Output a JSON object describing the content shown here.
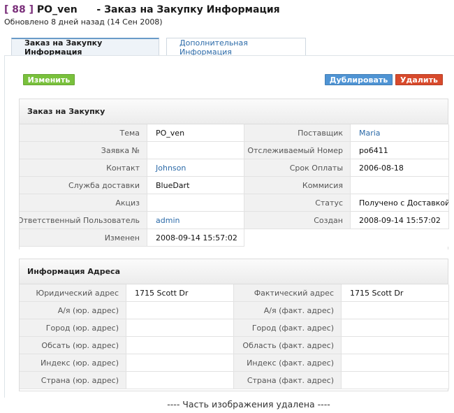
{
  "header": {
    "record_id": "[ 88 ]",
    "record_name": "PO_ven",
    "title_suffix": "- Заказ на Закупку Информация",
    "updated": "Обновлено 8 дней назад (14 Сен 2008)"
  },
  "tabs": [
    {
      "label": "Заказ на Закупку Информация",
      "active": true
    },
    {
      "label": "Дополнительная Информация",
      "active": false
    }
  ],
  "buttons": {
    "edit": "Изменить",
    "duplicate": "Дублировать",
    "delete": "Удалить"
  },
  "colors": {
    "edit": "#79c13c",
    "duplicate": "#4f94d4",
    "delete": "#d84a2c",
    "link": "#2b6aa8"
  },
  "po_section": {
    "title": "Заказ на Закупку",
    "rows": [
      {
        "l1": "Тема",
        "v1": "PO_ven",
        "l2": "Поставщик",
        "v2": "Maria"
      },
      {
        "l1": "Заявка №",
        "v1": "",
        "l2": "Отслеживаемый Номер",
        "v2": "po6411"
      },
      {
        "l1": "Контакт",
        "v1": "Johnson",
        "l2": "Срок Оплаты",
        "v2": "2006-08-18"
      },
      {
        "l1": "Служба доставки",
        "v1": "BlueDart",
        "l2": "Коммисия",
        "v2": ""
      },
      {
        "l1": "Акциз",
        "v1": "",
        "l2": "Статус",
        "v2": "Получено с Доставкой"
      },
      {
        "l1": "Ответственный Пользователь",
        "v1": "admin",
        "l2": "Создан",
        "v2": "2008-09-14 15:57:02"
      },
      {
        "l1": "Изменен",
        "v1": "2008-09-14 15:57:02"
      }
    ]
  },
  "address_section": {
    "title": "Информация Адреса",
    "rows": [
      {
        "l1": "Юридический адрес",
        "v1": "1715 Scott Dr",
        "l2": "Фактический адрес",
        "v2": "1715 Scott Dr"
      },
      {
        "l1": "А/я (юр. адрес)",
        "v1": "",
        "l2": "А/я (факт. адрес)",
        "v2": ""
      },
      {
        "l1": "Город (юр. адрес)",
        "v1": "",
        "l2": "Город (факт. адрес)",
        "v2": ""
      },
      {
        "l1": "Обсать (юр. адрес)",
        "v1": "",
        "l2": "Область (факт. адрес)",
        "v2": ""
      },
      {
        "l1": "Индекс (юр. адрес)",
        "v1": "",
        "l2": "Индекс (факт. адрес)",
        "v2": ""
      },
      {
        "l1": "Страна (юр. адрес)",
        "v1": "",
        "l2": "Страна (факт. адрес)",
        "v2": ""
      }
    ]
  },
  "footer_note": "---- Часть изображения удалена ----"
}
